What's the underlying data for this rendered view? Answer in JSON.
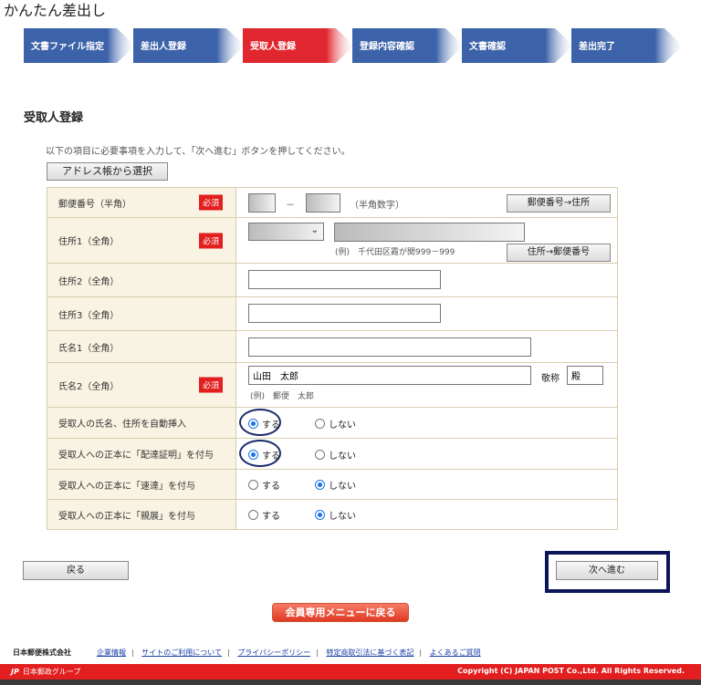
{
  "app_title": "かんたん差出し",
  "steps": [
    {
      "label": "文書ファイル指定",
      "active": false
    },
    {
      "label": "差出人登録",
      "active": false
    },
    {
      "label": "受取人登録",
      "active": true
    },
    {
      "label": "登録内容確認",
      "active": false
    },
    {
      "label": "文書確認",
      "active": false
    },
    {
      "label": "差出完了",
      "active": false
    }
  ],
  "colors": {
    "step_inactive": "#3c62a9",
    "step_active": "#e0262e",
    "required": "#e21e1e",
    "footer": "#e21e1e",
    "highlight": "#0d1559"
  },
  "section_title": "受取人登録",
  "instruction": "以下の項目に必要事項を入力して、「次へ進む」ボタンを押してください。",
  "address_book_button": "アドレス帳から選択",
  "required_label": "必須",
  "fields": {
    "postal": {
      "label": "郵便番号（半角）",
      "value1": "",
      "value2": "",
      "separator": "－",
      "hint": "（半角数字）",
      "button": "郵便番号→住所"
    },
    "address1": {
      "label": "住所1（全角）",
      "select_value": "",
      "value": "",
      "hint": "(例)　千代田区霞が関999－999",
      "button": "住所→郵便番号"
    },
    "address2": {
      "label": "住所2（全角）",
      "value": ""
    },
    "address3": {
      "label": "住所3（全角）",
      "value": ""
    },
    "name1": {
      "label": "氏名1（全角）",
      "value": ""
    },
    "name2": {
      "label": "氏名2（全角）",
      "value": "山田　太郎",
      "hint": "(例)　郵便　太郎",
      "honorific_label": "敬称",
      "honorific_value": "殿"
    }
  },
  "options": [
    {
      "label": "受取人の氏名、住所を自動挿入",
      "yes": "する",
      "no": "しない",
      "selected": "yes"
    },
    {
      "label": "受取人への正本に「配達証明」を付与",
      "yes": "する",
      "no": "しない",
      "selected": "yes"
    },
    {
      "label": "受取人への正本に「速達」を付与",
      "yes": "する",
      "no": "しない",
      "selected": "no"
    },
    {
      "label": "受取人への正本に「親展」を付与",
      "yes": "する",
      "no": "しない",
      "selected": "no"
    }
  ],
  "back_button": "戻る",
  "next_button": "次へ進む",
  "member_menu_button": "会員専用メニューに戻る",
  "footer": {
    "company": "日本郵便株式会社",
    "links": [
      "企業情報",
      "サイトのご利用について",
      "プライバシーポリシー",
      "特定商取引法に基づく表記",
      "よくあるご質問"
    ],
    "group_mark": "JP",
    "group_label": "日本郵政グループ",
    "copyright": "Copyright (C) JAPAN POST Co.,Ltd. All Rights Reserved."
  }
}
